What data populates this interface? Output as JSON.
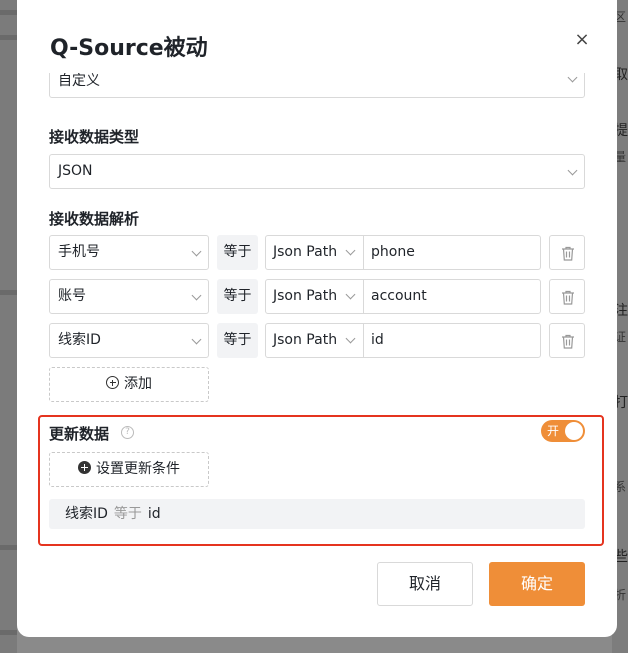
{
  "dialog": {
    "title": "Q-Source被动",
    "close_glyph": "×"
  },
  "top_select": {
    "value": "自定义"
  },
  "receive_type": {
    "label": "接收数据类型",
    "value": "JSON"
  },
  "parse": {
    "label": "接收数据解析",
    "rows": [
      {
        "field": "手机号",
        "operator": "等于",
        "source_type": "Json Path",
        "value": "phone"
      },
      {
        "field": "账号",
        "operator": "等于",
        "source_type": "Json Path",
        "value": "account"
      },
      {
        "field": "线索ID",
        "operator": "等于",
        "source_type": "Json Path",
        "value": "id"
      }
    ],
    "add_label": "添加"
  },
  "update": {
    "label": "更新数据",
    "help_glyph": "?",
    "toggle_on_label": "开",
    "toggle_state": true,
    "condition_button_label": "设置更新条件",
    "condition": {
      "field": "线索ID",
      "operator": "等于",
      "value": "id"
    }
  },
  "footer": {
    "cancel_label": "取消",
    "ok_label": "确定"
  },
  "background_fragments": [
    "区",
    "取",
    "提",
    "量",
    "注",
    "证",
    "打",
    "系",
    "些",
    "折"
  ],
  "colors": {
    "accent": "#ef8e38",
    "highlight_border": "#e5341f"
  }
}
